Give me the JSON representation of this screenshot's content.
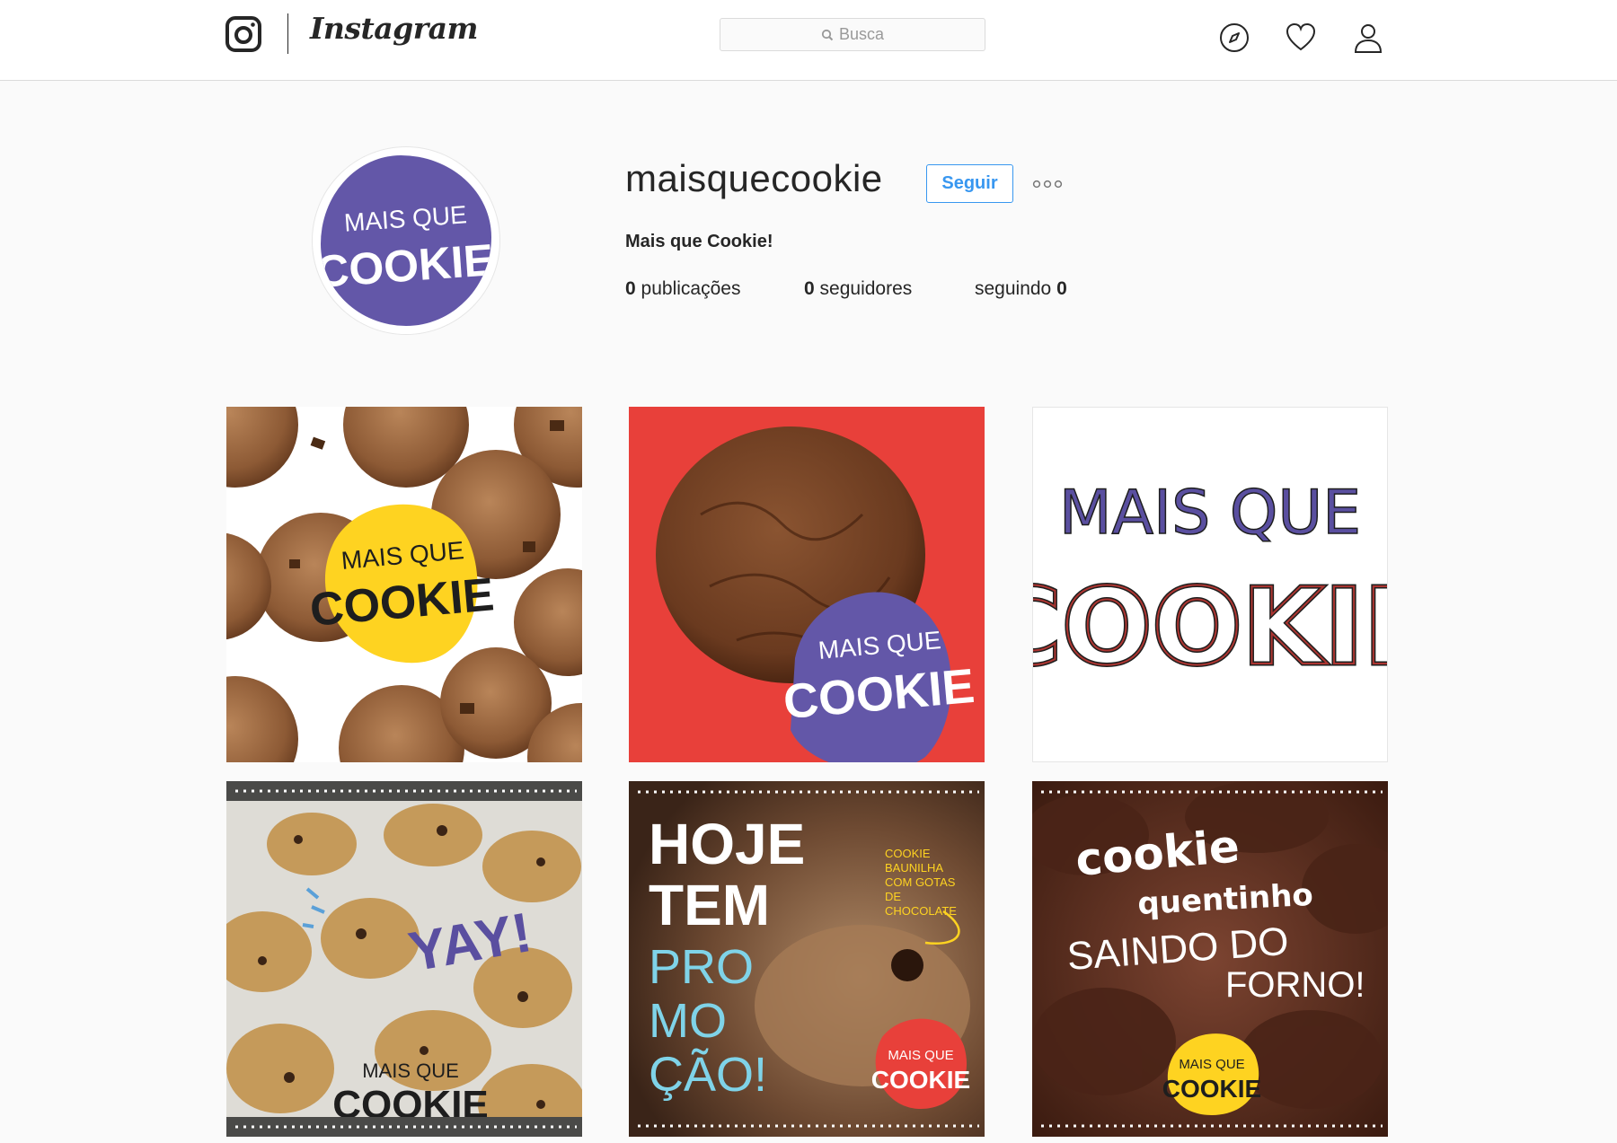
{
  "header": {
    "logo_word": "Instagram",
    "search_placeholder": "Busca",
    "icons": [
      "instagram-glyph-icon",
      "compass-icon",
      "heart-icon",
      "user-icon"
    ]
  },
  "profile": {
    "username": "maisquecookie",
    "follow_label": "Seguir",
    "full_name": "Mais que Cookie!",
    "avatar_text": {
      "top": "MAIS QUE",
      "bottom": "COOKIE"
    },
    "stats": [
      {
        "count": "0",
        "label": "publicações"
      },
      {
        "count": "0",
        "label": "seguidores"
      },
      {
        "prefix": "seguindo",
        "count": "0"
      }
    ]
  },
  "posts": [
    {
      "badge_top": "MAIS QUE",
      "badge_bottom": "COOKIE"
    },
    {
      "badge_top": "MAIS QUE",
      "badge_bottom": "COOKIE"
    },
    {
      "line1": "MAIS QUE",
      "line2": "COOKIE"
    },
    {
      "exclaim": "YAY!",
      "badge_top": "MAIS QUE",
      "badge_bottom": "COOKIE"
    },
    {
      "l1": "HOJE",
      "l2": "TEM",
      "l3": "PRO",
      "l4": "MO",
      "l5": "ÇÃO!",
      "note": [
        "COOKIE",
        "BAUNILHA",
        "COM GOTAS",
        "DE",
        "CHOCOLATE"
      ],
      "badge_top": "MAIS QUE",
      "badge_bottom": "COOKIE"
    },
    {
      "l1": "cookie",
      "l2": "quentinho",
      "l3": "SAINDO DO",
      "l4": "FORNO!",
      "badge_top": "MAIS QUE",
      "badge_bottom": "COOKIE"
    }
  ],
  "colors": {
    "brand_purple": "#6357a8",
    "brand_yellow": "#fed321",
    "promo_red": "#e8403a",
    "link_blue": "#3897f0"
  }
}
